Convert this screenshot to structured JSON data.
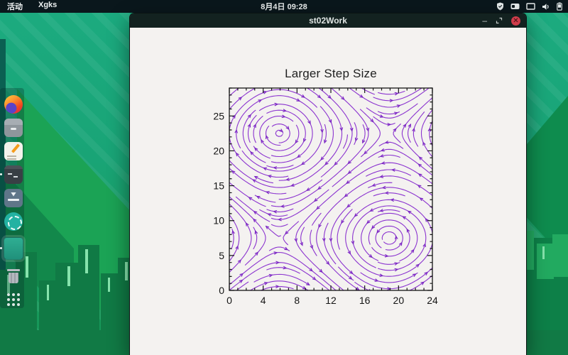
{
  "top_bar": {
    "activities_label": "活动",
    "app_name": "Xgks",
    "clock": "8月4日 09:28",
    "tray_icons": [
      "shield-icon",
      "input-device-icon",
      "display-icon",
      "volume-icon",
      "battery-icon"
    ]
  },
  "window": {
    "title": "st02Work",
    "minimize_glyph": "–",
    "close_glyph": "✕"
  },
  "dock": {
    "items": [
      {
        "icon": "firefox-icon",
        "running": false
      },
      {
        "icon": "archive-manager-icon",
        "running": false
      },
      {
        "icon": "text-editor-icon",
        "running": false
      },
      {
        "icon": "terminal-icon",
        "running": true
      },
      {
        "icon": "software-install-icon",
        "running": false
      },
      {
        "icon": "disc-app-icon",
        "running": false
      },
      {
        "icon": "xgks-window-icon",
        "running": true
      },
      {
        "icon": "trash-icon",
        "running": false
      },
      {
        "icon": "show-apps-icon",
        "running": false
      }
    ]
  },
  "colors": {
    "wallpaper_teal": "#1cab80",
    "wallpaper_green": "#1ba355",
    "topbar": "#0a171c",
    "titlebar": "#132220",
    "window_bg": "#f4f2f0",
    "close_button": "#cf3d4b",
    "streamline": "#8b33cf"
  },
  "chart_data": {
    "type": "streamline",
    "title": "Larger Step Size",
    "xlabel": "",
    "ylabel": "",
    "x_range": [
      0,
      24
    ],
    "y_range": [
      0,
      29
    ],
    "x_major_ticks": [
      0,
      4,
      8,
      12,
      16,
      20,
      24
    ],
    "y_major_ticks": [
      0,
      5,
      10,
      15,
      20,
      25
    ],
    "minor_tick_step": 1,
    "grid": false,
    "frame": "box-with-inward-ticks",
    "line_color": "#8b33cf",
    "arrow_color": "#7a27c2",
    "frame_color": "#141414",
    "field": {
      "u": "-sin(2*pi*(y-7.5)/30)",
      "v": "-sin(2*pi*(x-5.9)/26)",
      "u_params": {
        "sign": -1,
        "period": 30,
        "phase": 7.5,
        "depends_on": "y"
      },
      "v_params": {
        "sign": -1,
        "period": 26,
        "phase": 5.9,
        "depends_on": "x"
      },
      "vortices": [
        {
          "x": 5.9,
          "y": 22.5,
          "rotation": "clockwise"
        },
        {
          "x": 18.9,
          "y": 7.5,
          "rotation": "counterclockwise"
        }
      ],
      "saddles": [
        {
          "x": 18.9,
          "y": 22.5
        },
        {
          "x": 5.9,
          "y": 7.5
        }
      ]
    },
    "render": {
      "seed_step": 0.9,
      "step_size": 0.3,
      "cell_size": 0.7,
      "arrow_spacing_px": 55
    }
  }
}
